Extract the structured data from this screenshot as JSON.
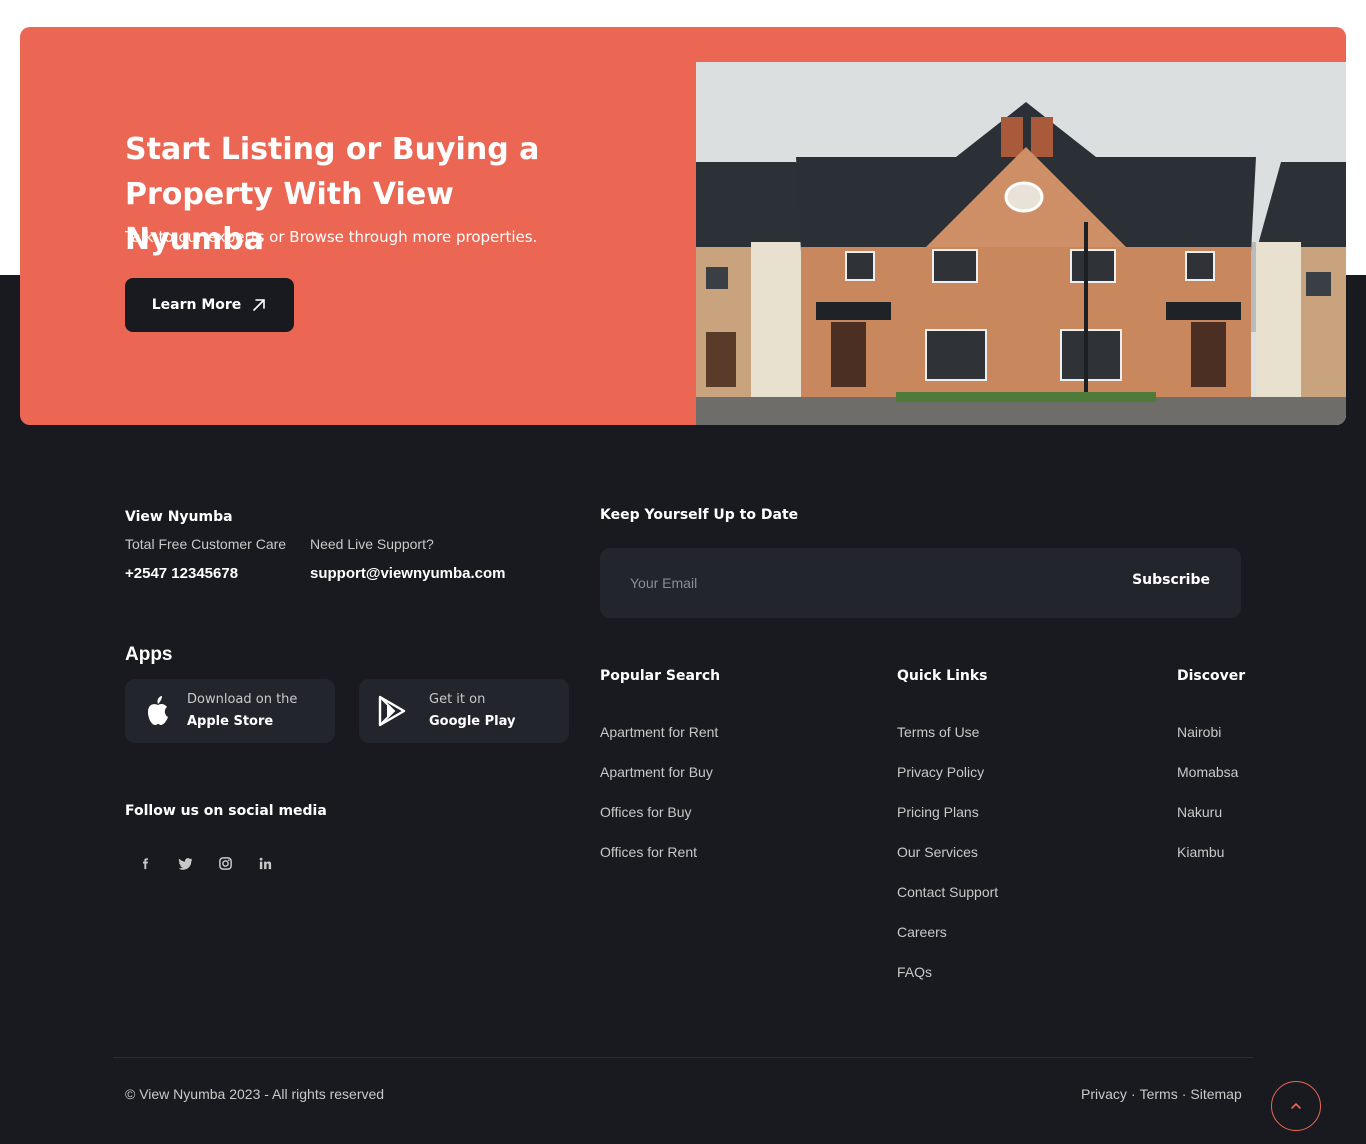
{
  "cta": {
    "title": "Start Listing or Buying a Property With View Nyumba",
    "subtitle": "Talk to our experts or Browse through more properties.",
    "button_label": "Learn More"
  },
  "footer": {
    "brand": "View Nyumba",
    "customer_care_label": "Total Free Customer Care",
    "customer_care_phone": "+2547 12345678",
    "support_label": "Need Live Support?",
    "support_email": "support@viewnyumba.com",
    "apps": {
      "title": "Apps",
      "apple": {
        "small": "Download on the",
        "big": "Apple Store"
      },
      "google": {
        "small": "Get it on",
        "big": "Google Play"
      }
    },
    "social": {
      "title": "Follow us on social media",
      "icons": [
        "facebook-icon",
        "twitter-icon",
        "instagram-icon",
        "linkedin-icon"
      ]
    },
    "newsletter": {
      "title": "Keep Yourself Up to Date",
      "placeholder": "Your Email",
      "button": "Subscribe"
    },
    "columns": [
      {
        "title": "Popular Search",
        "items": [
          "Apartment for Rent",
          "Apartment for Buy",
          "Offices for Buy",
          "Offices for Rent"
        ]
      },
      {
        "title": "Quick Links",
        "items": [
          "Terms of Use",
          "Privacy Policy",
          "Pricing Plans",
          "Our Services",
          "Contact Support",
          "Careers",
          "FAQs"
        ]
      },
      {
        "title": "Discover",
        "items": [
          "Nairobi",
          "Momabsa",
          "Nakuru",
          "Kiambu"
        ]
      }
    ],
    "copyright": "© View Nyumba 2023 - All rights reserved",
    "legal": {
      "privacy": "Privacy",
      "terms": "Terms",
      "sitemap": "Sitemap",
      "separator": "·"
    }
  },
  "colors": {
    "accent": "#eb6753",
    "dark": "#181a20",
    "card": "#22252c"
  }
}
